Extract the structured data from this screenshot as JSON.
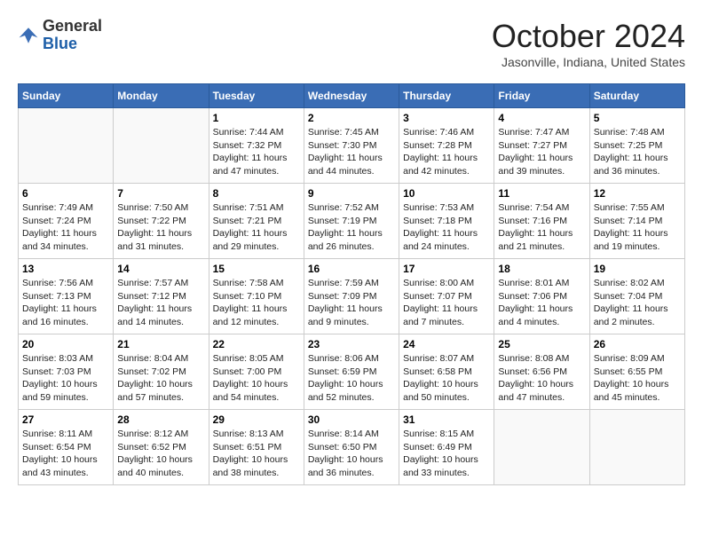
{
  "header": {
    "logo_line1": "General",
    "logo_line2": "Blue",
    "month": "October 2024",
    "location": "Jasonville, Indiana, United States"
  },
  "weekdays": [
    "Sunday",
    "Monday",
    "Tuesday",
    "Wednesday",
    "Thursday",
    "Friday",
    "Saturday"
  ],
  "weeks": [
    [
      {
        "day": "",
        "sunrise": "",
        "sunset": "",
        "daylight": ""
      },
      {
        "day": "",
        "sunrise": "",
        "sunset": "",
        "daylight": ""
      },
      {
        "day": "1",
        "sunrise": "Sunrise: 7:44 AM",
        "sunset": "Sunset: 7:32 PM",
        "daylight": "Daylight: 11 hours and 47 minutes."
      },
      {
        "day": "2",
        "sunrise": "Sunrise: 7:45 AM",
        "sunset": "Sunset: 7:30 PM",
        "daylight": "Daylight: 11 hours and 44 minutes."
      },
      {
        "day": "3",
        "sunrise": "Sunrise: 7:46 AM",
        "sunset": "Sunset: 7:28 PM",
        "daylight": "Daylight: 11 hours and 42 minutes."
      },
      {
        "day": "4",
        "sunrise": "Sunrise: 7:47 AM",
        "sunset": "Sunset: 7:27 PM",
        "daylight": "Daylight: 11 hours and 39 minutes."
      },
      {
        "day": "5",
        "sunrise": "Sunrise: 7:48 AM",
        "sunset": "Sunset: 7:25 PM",
        "daylight": "Daylight: 11 hours and 36 minutes."
      }
    ],
    [
      {
        "day": "6",
        "sunrise": "Sunrise: 7:49 AM",
        "sunset": "Sunset: 7:24 PM",
        "daylight": "Daylight: 11 hours and 34 minutes."
      },
      {
        "day": "7",
        "sunrise": "Sunrise: 7:50 AM",
        "sunset": "Sunset: 7:22 PM",
        "daylight": "Daylight: 11 hours and 31 minutes."
      },
      {
        "day": "8",
        "sunrise": "Sunrise: 7:51 AM",
        "sunset": "Sunset: 7:21 PM",
        "daylight": "Daylight: 11 hours and 29 minutes."
      },
      {
        "day": "9",
        "sunrise": "Sunrise: 7:52 AM",
        "sunset": "Sunset: 7:19 PM",
        "daylight": "Daylight: 11 hours and 26 minutes."
      },
      {
        "day": "10",
        "sunrise": "Sunrise: 7:53 AM",
        "sunset": "Sunset: 7:18 PM",
        "daylight": "Daylight: 11 hours and 24 minutes."
      },
      {
        "day": "11",
        "sunrise": "Sunrise: 7:54 AM",
        "sunset": "Sunset: 7:16 PM",
        "daylight": "Daylight: 11 hours and 21 minutes."
      },
      {
        "day": "12",
        "sunrise": "Sunrise: 7:55 AM",
        "sunset": "Sunset: 7:14 PM",
        "daylight": "Daylight: 11 hours and 19 minutes."
      }
    ],
    [
      {
        "day": "13",
        "sunrise": "Sunrise: 7:56 AM",
        "sunset": "Sunset: 7:13 PM",
        "daylight": "Daylight: 11 hours and 16 minutes."
      },
      {
        "day": "14",
        "sunrise": "Sunrise: 7:57 AM",
        "sunset": "Sunset: 7:12 PM",
        "daylight": "Daylight: 11 hours and 14 minutes."
      },
      {
        "day": "15",
        "sunrise": "Sunrise: 7:58 AM",
        "sunset": "Sunset: 7:10 PM",
        "daylight": "Daylight: 11 hours and 12 minutes."
      },
      {
        "day": "16",
        "sunrise": "Sunrise: 7:59 AM",
        "sunset": "Sunset: 7:09 PM",
        "daylight": "Daylight: 11 hours and 9 minutes."
      },
      {
        "day": "17",
        "sunrise": "Sunrise: 8:00 AM",
        "sunset": "Sunset: 7:07 PM",
        "daylight": "Daylight: 11 hours and 7 minutes."
      },
      {
        "day": "18",
        "sunrise": "Sunrise: 8:01 AM",
        "sunset": "Sunset: 7:06 PM",
        "daylight": "Daylight: 11 hours and 4 minutes."
      },
      {
        "day": "19",
        "sunrise": "Sunrise: 8:02 AM",
        "sunset": "Sunset: 7:04 PM",
        "daylight": "Daylight: 11 hours and 2 minutes."
      }
    ],
    [
      {
        "day": "20",
        "sunrise": "Sunrise: 8:03 AM",
        "sunset": "Sunset: 7:03 PM",
        "daylight": "Daylight: 10 hours and 59 minutes."
      },
      {
        "day": "21",
        "sunrise": "Sunrise: 8:04 AM",
        "sunset": "Sunset: 7:02 PM",
        "daylight": "Daylight: 10 hours and 57 minutes."
      },
      {
        "day": "22",
        "sunrise": "Sunrise: 8:05 AM",
        "sunset": "Sunset: 7:00 PM",
        "daylight": "Daylight: 10 hours and 54 minutes."
      },
      {
        "day": "23",
        "sunrise": "Sunrise: 8:06 AM",
        "sunset": "Sunset: 6:59 PM",
        "daylight": "Daylight: 10 hours and 52 minutes."
      },
      {
        "day": "24",
        "sunrise": "Sunrise: 8:07 AM",
        "sunset": "Sunset: 6:58 PM",
        "daylight": "Daylight: 10 hours and 50 minutes."
      },
      {
        "day": "25",
        "sunrise": "Sunrise: 8:08 AM",
        "sunset": "Sunset: 6:56 PM",
        "daylight": "Daylight: 10 hours and 47 minutes."
      },
      {
        "day": "26",
        "sunrise": "Sunrise: 8:09 AM",
        "sunset": "Sunset: 6:55 PM",
        "daylight": "Daylight: 10 hours and 45 minutes."
      }
    ],
    [
      {
        "day": "27",
        "sunrise": "Sunrise: 8:11 AM",
        "sunset": "Sunset: 6:54 PM",
        "daylight": "Daylight: 10 hours and 43 minutes."
      },
      {
        "day": "28",
        "sunrise": "Sunrise: 8:12 AM",
        "sunset": "Sunset: 6:52 PM",
        "daylight": "Daylight: 10 hours and 40 minutes."
      },
      {
        "day": "29",
        "sunrise": "Sunrise: 8:13 AM",
        "sunset": "Sunset: 6:51 PM",
        "daylight": "Daylight: 10 hours and 38 minutes."
      },
      {
        "day": "30",
        "sunrise": "Sunrise: 8:14 AM",
        "sunset": "Sunset: 6:50 PM",
        "daylight": "Daylight: 10 hours and 36 minutes."
      },
      {
        "day": "31",
        "sunrise": "Sunrise: 8:15 AM",
        "sunset": "Sunset: 6:49 PM",
        "daylight": "Daylight: 10 hours and 33 minutes."
      },
      {
        "day": "",
        "sunrise": "",
        "sunset": "",
        "daylight": ""
      },
      {
        "day": "",
        "sunrise": "",
        "sunset": "",
        "daylight": ""
      }
    ]
  ]
}
